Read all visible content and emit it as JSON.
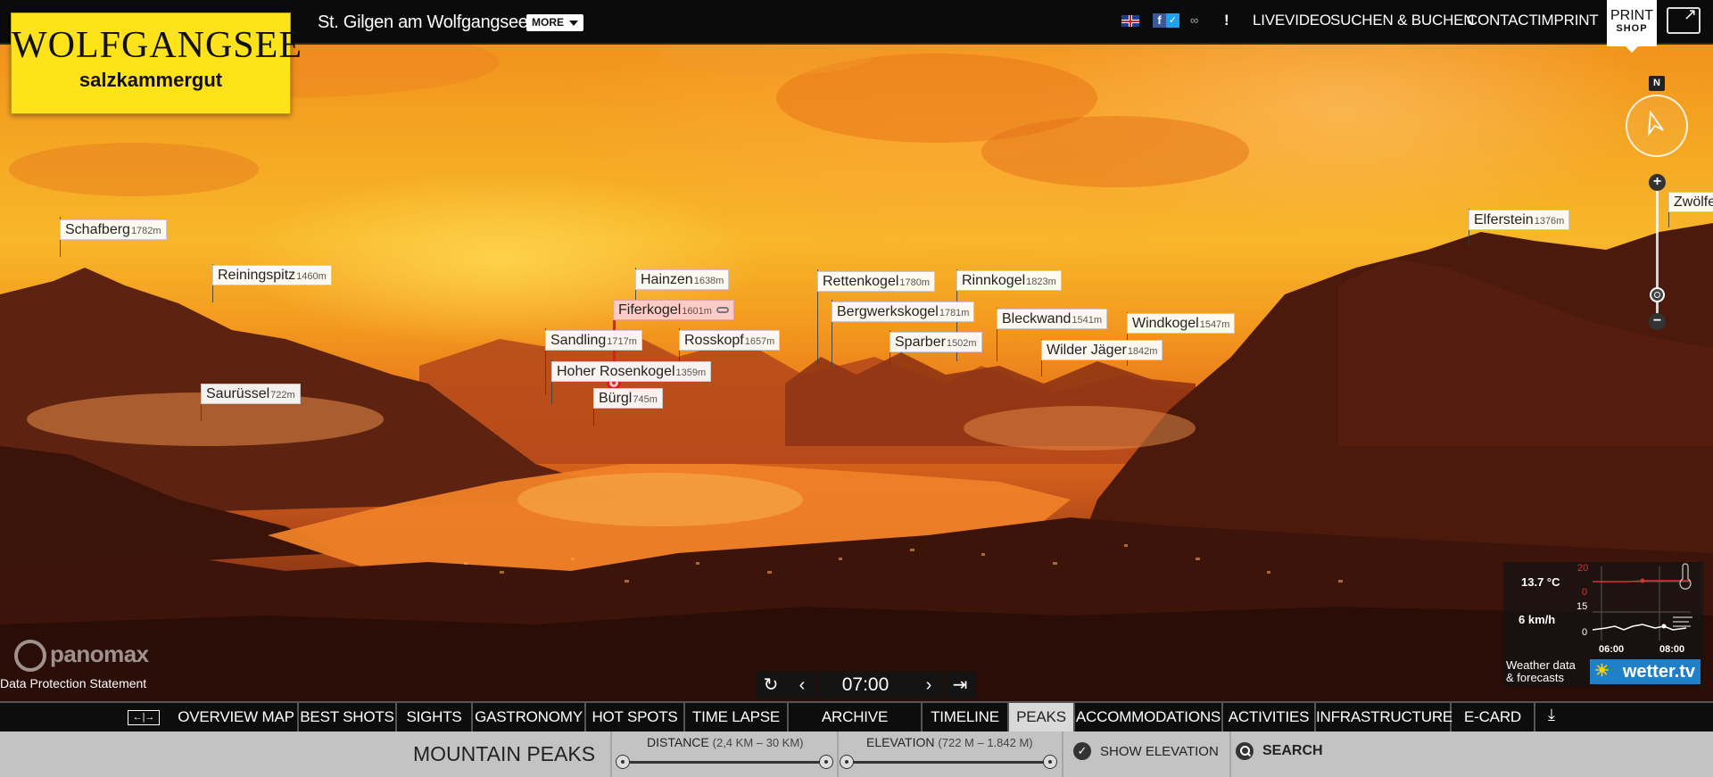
{
  "header": {
    "logo_line1": "WOLFGANGSEE",
    "logo_line2": "salzkammergut",
    "place_title": "St. Gilgen am Wolfgangsee",
    "more_label": "MORE",
    "exclamation": "!",
    "nav_links": [
      "LIVEVIDEO",
      "SUCHEN & BUCHEN",
      "CONTACT",
      "IMPRINT"
    ],
    "print_shop_line1": "PRINT",
    "print_shop_line2": "SHOP",
    "icons": [
      "flag-uk-icon",
      "facebook-icon",
      "twitter-icon",
      "link-icon",
      "fullscreen-icon"
    ]
  },
  "compass": {
    "north_label": "N"
  },
  "zoom": {
    "in_label": "+",
    "out_label": "−"
  },
  "peaks": [
    {
      "name": "Schafberg",
      "elevation": "1782m"
    },
    {
      "name": "Reiningspitz",
      "elevation": "1460m"
    },
    {
      "name": "Hainzen",
      "elevation": "1638m"
    },
    {
      "name": "Fiferkogel",
      "elevation": "1601m",
      "highlighted": true
    },
    {
      "name": "Sandling",
      "elevation": "1717m"
    },
    {
      "name": "Rosskopf",
      "elevation": "1657m"
    },
    {
      "name": "Hoher Rosenkogel",
      "elevation": "1359m"
    },
    {
      "name": "Bürgl",
      "elevation": "745m"
    },
    {
      "name": "Saurüssel",
      "elevation": "722m"
    },
    {
      "name": "Rettenkogel",
      "elevation": "1780m"
    },
    {
      "name": "Rinnkogel",
      "elevation": "1823m"
    },
    {
      "name": "Bergwerkskogel",
      "elevation": "1781m"
    },
    {
      "name": "Sparber",
      "elevation": "1502m"
    },
    {
      "name": "Bleckwand",
      "elevation": "1541m"
    },
    {
      "name": "Windkogel",
      "elevation": "1547m"
    },
    {
      "name": "Wilder Jäger",
      "elevation": "1842m"
    },
    {
      "name": "Elferstein",
      "elevation": "1376m"
    },
    {
      "name": "Zwölfe",
      "elevation": ""
    }
  ],
  "footer_left": {
    "brand": "panomax",
    "data_protection": "Data Protection Statement"
  },
  "time_controls": {
    "time": "07:00",
    "icons": [
      "replay-icon",
      "prev-icon",
      "next-icon",
      "last-icon"
    ]
  },
  "weather": {
    "temperature": "13.7 °C",
    "wind": "6 km/h",
    "temp_axis_max": "20",
    "temp_axis_min": "0",
    "wind_axis_max": "15",
    "wind_axis_min": "0",
    "time_1": "06:00",
    "time_2": "08:00",
    "label_line1": "Weather data",
    "label_line2": "& forecasts",
    "provider": "wetter.tv",
    "accent_temp": "#e03030"
  },
  "nav_primary": {
    "expand_label": "←|→",
    "tabs": [
      "OVERVIEW MAP",
      "BEST SHOTS",
      "SIGHTS",
      "GASTRONOMY",
      "HOT SPOTS",
      "TIME LAPSE",
      "ARCHIVE",
      "TIMELINE",
      "PEAKS",
      "ACCOMMODATIONS",
      "ACTIVITIES",
      "INFRASTRUCTURE",
      "E-CARD"
    ],
    "active_tab": "PEAKS"
  },
  "peaks_panel": {
    "title": "MOUNTAIN PEAKS",
    "distance_label": "DISTANCE",
    "distance_range": "(2,4 KM – 30 KM)",
    "elevation_label": "ELEVATION",
    "elevation_range": "(722 M – 1.842 M)",
    "show_elevation": "SHOW ELEVATION",
    "search": "SEARCH"
  },
  "colors": {
    "logo_bg": "#fee21a",
    "topbar_bg": "#0b0b0b",
    "highlight_line": "#d42222"
  }
}
